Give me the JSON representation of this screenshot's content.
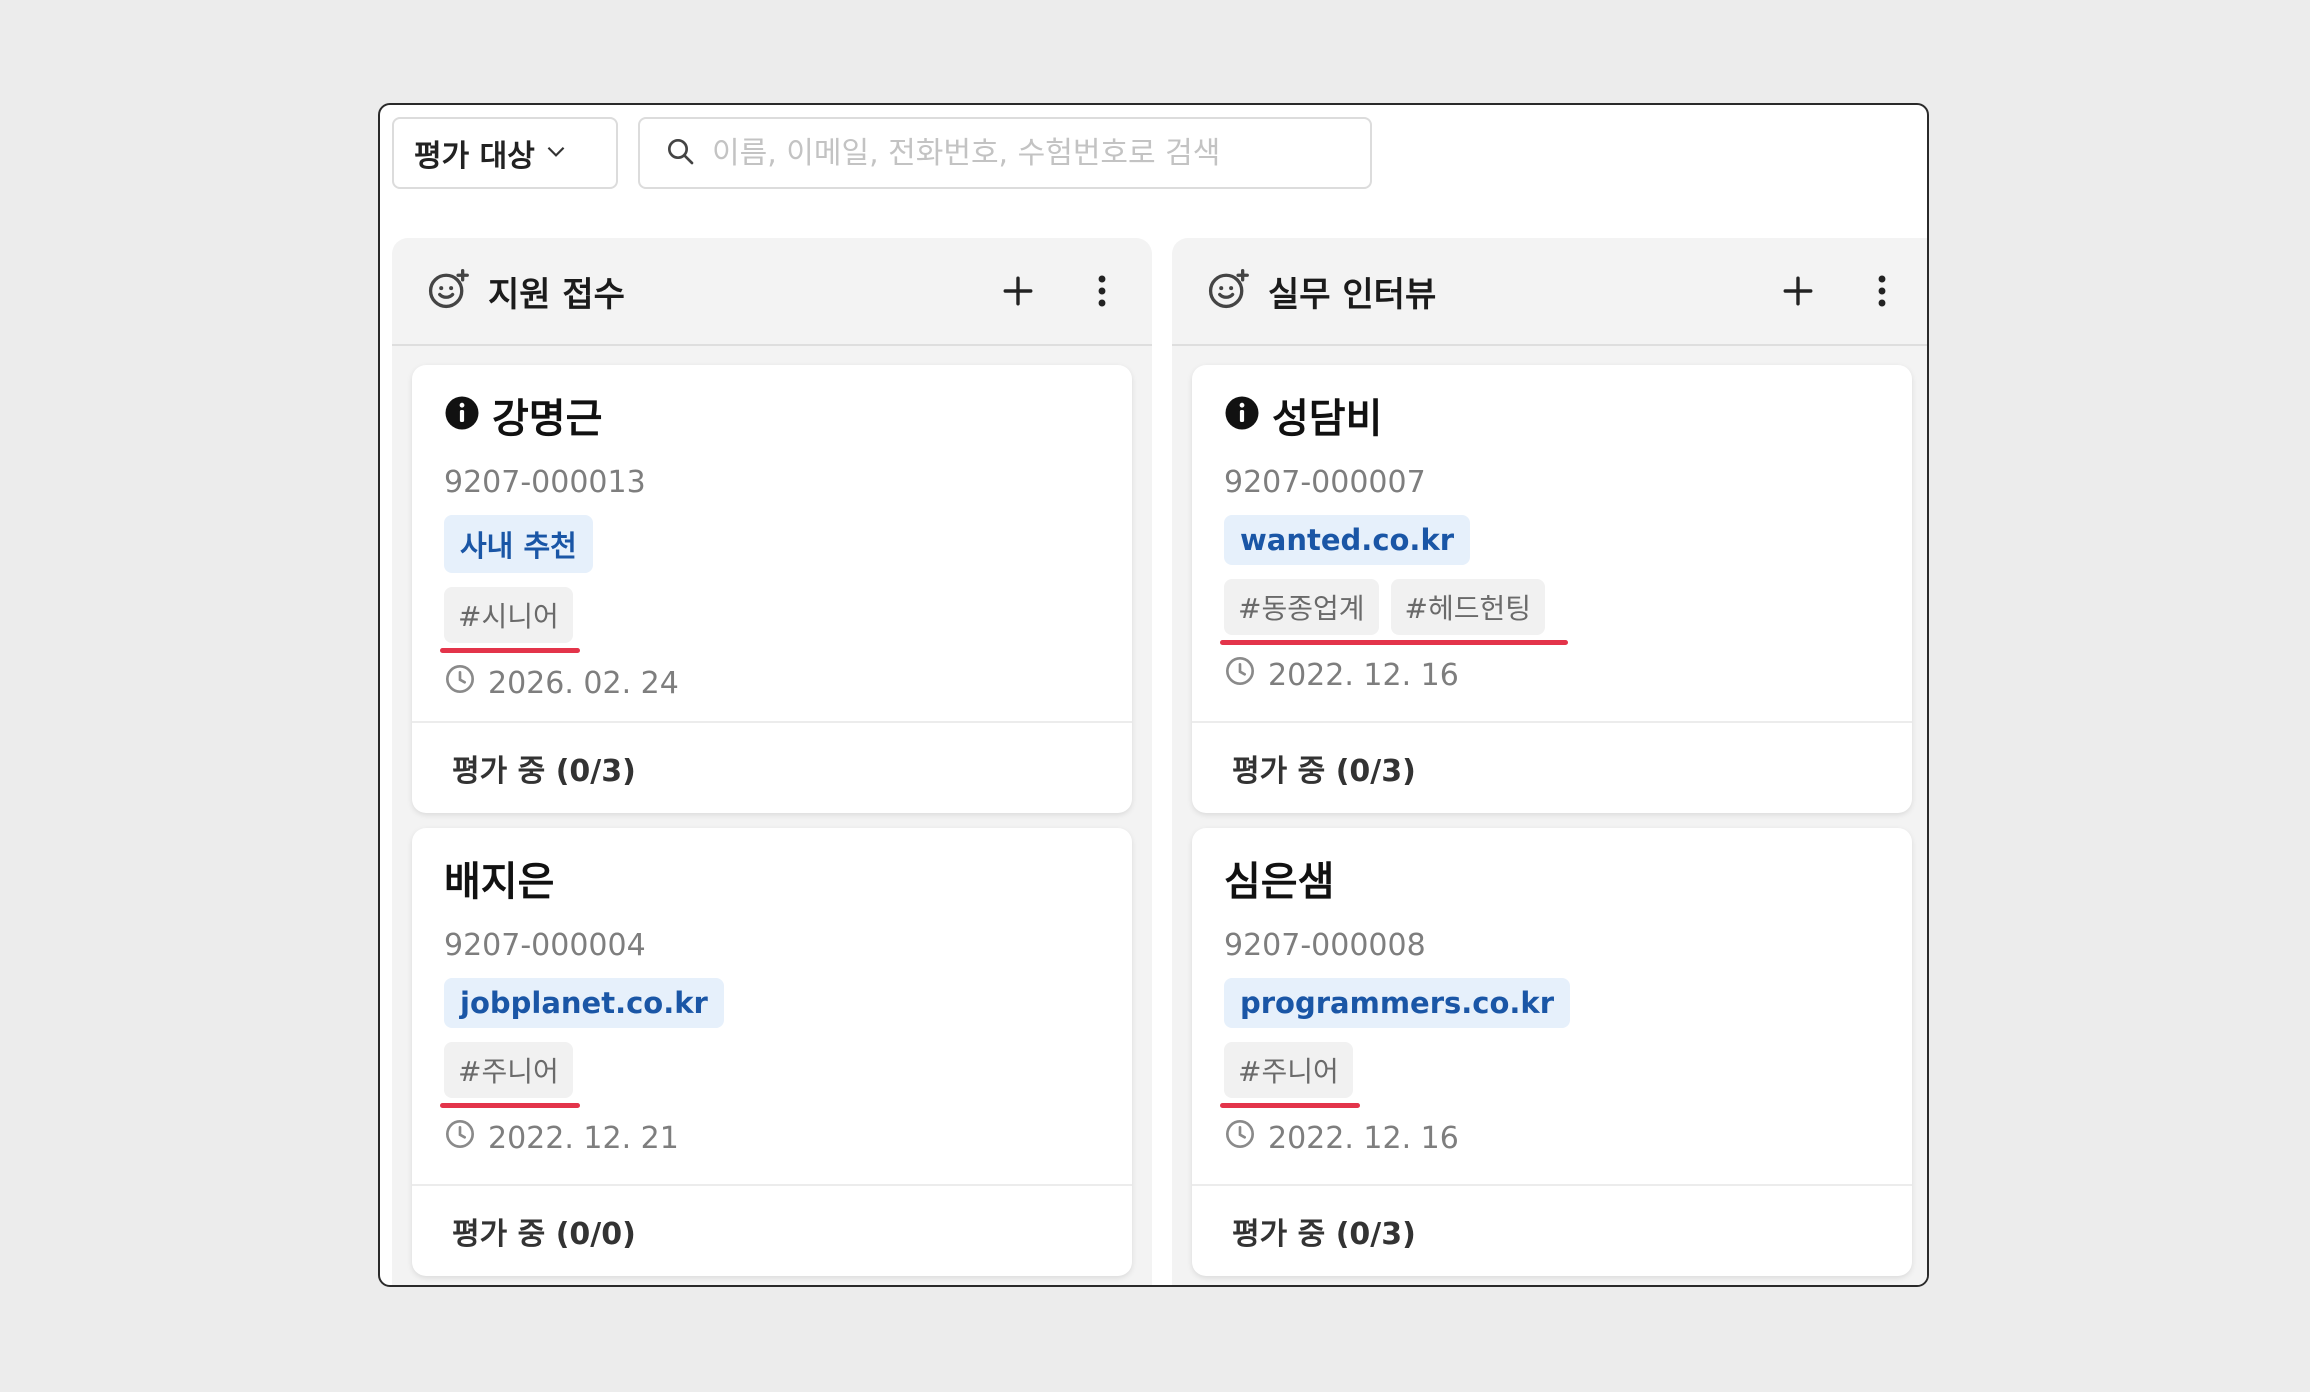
{
  "toolbar": {
    "filter_label": "평가 대상",
    "search_placeholder": "이름, 이메일, 전화번호, 수험번호로 검색"
  },
  "columns": [
    {
      "title": "지원 접수",
      "cards": [
        {
          "name": "강명근",
          "id": "9207-000013",
          "source": "사내 추천",
          "tags": [
            "#시니어"
          ],
          "date": "2026. 02. 24",
          "status": "평가 중 (0/3)"
        },
        {
          "name": "배지은",
          "id": "9207-000004",
          "source": "jobplanet.co.kr",
          "tags": [
            "#주니어"
          ],
          "date": "2022. 12. 21",
          "status": "평가 중 (0/0)"
        }
      ]
    },
    {
      "title": "실무 인터뷰",
      "cards": [
        {
          "name": "성담비",
          "id": "9207-000007",
          "source": "wanted.co.kr",
          "tags": [
            "#동종업계",
            "#헤드헌팅"
          ],
          "date": "2022. 12. 16",
          "status": "평가 중 (0/3)"
        },
        {
          "name": "심은샘",
          "id": "9207-000008",
          "source": "programmers.co.kr",
          "tags": [
            "#주니어"
          ],
          "date": "2022. 12. 16",
          "status": "평가 중 (0/3)"
        }
      ]
    }
  ],
  "colors": {
    "accent_underline": "#e3344a",
    "source_bg": "#e6f0fb",
    "source_text": "#1a56a6"
  }
}
